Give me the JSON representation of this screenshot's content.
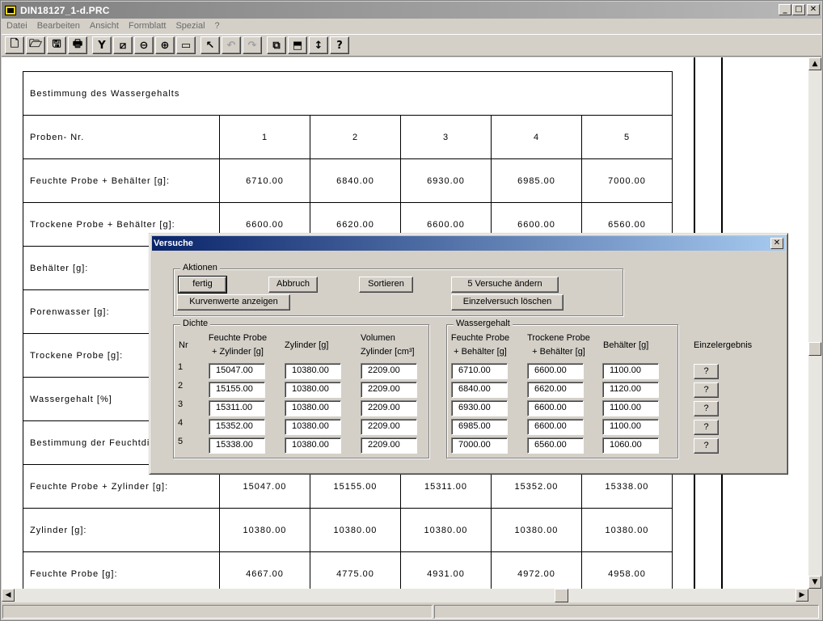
{
  "window": {
    "title": "DIN18127_1-d.PRC"
  },
  "menu": [
    "Datei",
    "Bearbeiten",
    "Ansicht",
    "Formblatt",
    "Spezial",
    "?"
  ],
  "toolbar": [
    {
      "icon": "new-document-icon",
      "glyph": "🗋"
    },
    {
      "icon": "open-folder-icon",
      "glyph": "🗁"
    },
    {
      "icon": "save-icon",
      "glyph": "🖫"
    },
    {
      "icon": "print-icon",
      "glyph": "🖶"
    },
    {
      "icon": "tools-icon",
      "glyph": "Y"
    },
    {
      "icon": "print-preview-icon",
      "glyph": "⧄"
    },
    {
      "icon": "zoom-out-icon",
      "glyph": "⊖"
    },
    {
      "icon": "zoom-in-icon",
      "glyph": "⊕"
    },
    {
      "icon": "frame-icon",
      "glyph": "▭"
    },
    {
      "icon": "pointer-icon",
      "glyph": "↖"
    },
    {
      "icon": "undo-icon",
      "glyph": "↶",
      "disabled": true
    },
    {
      "icon": "redo-icon",
      "glyph": "↷",
      "disabled": true
    },
    {
      "icon": "form-icon",
      "glyph": "⧉"
    },
    {
      "icon": "export-icon",
      "glyph": "⬒"
    },
    {
      "icon": "vertical-resize-icon",
      "glyph": "↕"
    },
    {
      "icon": "help-icon",
      "glyph": "?"
    }
  ],
  "sheet": {
    "water_content_title": "Bestimmung des Wassergehalts",
    "sample_header": "Proben- Nr.",
    "sample_numbers": [
      "1",
      "2",
      "3",
      "4",
      "5"
    ],
    "rows_top": [
      {
        "label": "Feuchte Probe + Behälter [g]:",
        "values": [
          "6710.00",
          "6840.00",
          "6930.00",
          "6985.00",
          "7000.00"
        ]
      },
      {
        "label": "Trockene Probe + Behälter [g]:",
        "values": [
          "6600.00",
          "6620.00",
          "6600.00",
          "6600.00",
          "6560.00"
        ]
      },
      {
        "label": "Behälter [g]:",
        "values": [
          "",
          "",
          "",
          "",
          ""
        ]
      },
      {
        "label": "Porenwasser [g]:",
        "values": [
          "",
          "",
          "",
          "",
          ""
        ]
      },
      {
        "label": "Trockene Probe [g]:",
        "values": [
          "",
          "",
          "",
          "",
          ""
        ]
      },
      {
        "label": "Wassergehalt [%]",
        "values": [
          "",
          "",
          "",
          "",
          ""
        ]
      }
    ],
    "density_title": "Bestimmung der Feuchtdichte",
    "rows_bottom": [
      {
        "label": "Feuchte Probe + Zylinder [g]:",
        "values": [
          "15047.00",
          "15155.00",
          "15311.00",
          "15352.00",
          "15338.00"
        ]
      },
      {
        "label": "Zylinder [g]:",
        "values": [
          "10380.00",
          "10380.00",
          "10380.00",
          "10380.00",
          "10380.00"
        ]
      },
      {
        "label": "Feuchte Probe [g]:",
        "values": [
          "4667.00",
          "4775.00",
          "4931.00",
          "4972.00",
          "4958.00"
        ]
      }
    ]
  },
  "dialog": {
    "title": "Versuche",
    "actions_caption": "Aktionen",
    "buttons": {
      "done": "fertig",
      "cancel": "Abbruch",
      "sort": "Sortieren",
      "edit_trials": "5 Versuche ändern",
      "show_curve": "Kurvenwerte anzeigen",
      "delete_trial": "Einzelversuch löschen"
    },
    "density_caption": "Dichte",
    "water_caption": "Wassergehalt",
    "headers": {
      "nr": "Nr",
      "wet_cyl_1": "Feuchte Probe",
      "wet_cyl_2": "+ Zylinder [g]",
      "cylinder": "Zylinder [g]",
      "volume_1": "Volumen",
      "volume_2": "Zylinder [cm³]",
      "wet_cont_1": "Feuchte Probe",
      "wet_cont_2": "+ Behälter [g]",
      "dry_cont_1": "Trockene Probe",
      "dry_cont_2": "+ Behälter [g]",
      "container": "Behälter [g]",
      "single_result": "Einzelergebnis"
    },
    "trials": [
      {
        "nr": "1",
        "wet_cyl": "15047.00",
        "cylinder": "10380.00",
        "volume": "2209.00",
        "wet_cont": "6710.00",
        "dry_cont": "6600.00",
        "container": "1100.00"
      },
      {
        "nr": "2",
        "wet_cyl": "15155.00",
        "cylinder": "10380.00",
        "volume": "2209.00",
        "wet_cont": "6840.00",
        "dry_cont": "6620.00",
        "container": "1120.00"
      },
      {
        "nr": "3",
        "wet_cyl": "15311.00",
        "cylinder": "10380.00",
        "volume": "2209.00",
        "wet_cont": "6930.00",
        "dry_cont": "6600.00",
        "container": "1100.00"
      },
      {
        "nr": "4",
        "wet_cyl": "15352.00",
        "cylinder": "10380.00",
        "volume": "2209.00",
        "wet_cont": "6985.00",
        "dry_cont": "6600.00",
        "container": "1100.00"
      },
      {
        "nr": "5",
        "wet_cyl": "15338.00",
        "cylinder": "10380.00",
        "volume": "2209.00",
        "wet_cont": "7000.00",
        "dry_cont": "6560.00",
        "container": "1060.00"
      }
    ],
    "result_button": "?"
  }
}
